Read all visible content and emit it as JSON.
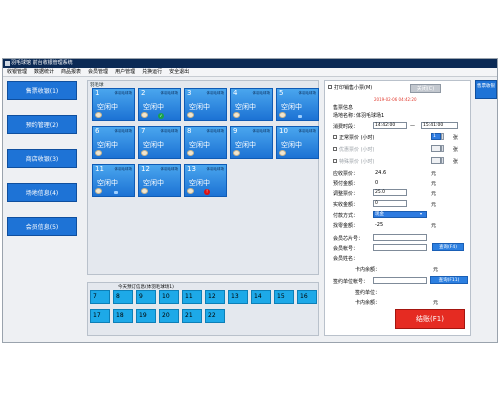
{
  "window": {
    "title": "羽毛球馆 前台收银管理系统"
  },
  "menu": [
    "收银管理",
    "数据统计",
    "商品报表",
    "会员管理",
    "用户管理",
    "兑换运行",
    "安全退出"
  ],
  "nav": [
    "售票收银(1)",
    "预约管理(2)",
    "商店收银(3)",
    "场地信息(4)",
    "会员信息(5)"
  ],
  "rooms": {
    "header": "羽毛球",
    "tag": "体羽毛球场",
    "status": "空闲中",
    "tiles": [
      {
        "no": "1",
        "mark": ""
      },
      {
        "no": "2",
        "mark": "ok"
      },
      {
        "no": "3",
        "mark": ""
      },
      {
        "no": "4",
        "mark": ""
      },
      {
        "no": "5",
        "mark": "lamp"
      },
      {
        "no": "6",
        "mark": ""
      },
      {
        "no": "7",
        "mark": ""
      },
      {
        "no": "8",
        "mark": ""
      },
      {
        "no": "9",
        "mark": ""
      },
      {
        "no": "10",
        "mark": ""
      },
      {
        "no": "11",
        "mark": "lamp"
      },
      {
        "no": "12",
        "mark": ""
      },
      {
        "no": "13",
        "mark": "warn"
      }
    ]
  },
  "reservation": {
    "header": "今天预订信息(体羽毛球场1)",
    "row1": [
      "7",
      "8",
      "9",
      "10",
      "11",
      "12",
      "13",
      "14",
      "15",
      "16"
    ],
    "row2": [
      "17",
      "18",
      "19",
      "20",
      "21",
      "22"
    ]
  },
  "detail": {
    "print_label": "打印销售小票(M)",
    "close_label": "关闭(C)",
    "timestamp": "2019-02-06 04:42:20",
    "section_title": "售票信息",
    "venue_label": "场地名称：",
    "venue_value": "体羽毛球场1",
    "time_label": "消费时段：",
    "time_start": "14:42:00",
    "time_end": "15:41:00",
    "time_sep": "—",
    "normal_label": "正常票价 (小时)",
    "normal_value": "1",
    "discount_label": "优惠票价 (小时)",
    "special_label": "特殊票价 (小时)",
    "unit_zhang": "张",
    "payable_label": "应收票价：",
    "payable_value": "24.6",
    "deposit_label": "预付金额：",
    "deposit_value": "0",
    "adjust_label": "调整票价：",
    "adjust_value": "25.0",
    "received_label": "实收金额：",
    "received_value": "0",
    "paymethod_label": "付款方式：",
    "paymethod_value": "现金",
    "change_label": "找零金额：",
    "change_value": "-25",
    "unit_yuan": "元",
    "card_label": "会员芯片号：",
    "account_label": "会员帐号：",
    "query_f4": "查询(F4)",
    "name_label": "会员姓名：",
    "card_balance_label": "卡内余额：",
    "sign_label": "签约单位帐号：",
    "query_f11": "查询(F11)",
    "sign_unit_label": "签约单位：",
    "sign_balance_label": "卡内余额：",
    "checkout_label": "结账(F1)"
  },
  "right_button": "售票收银"
}
